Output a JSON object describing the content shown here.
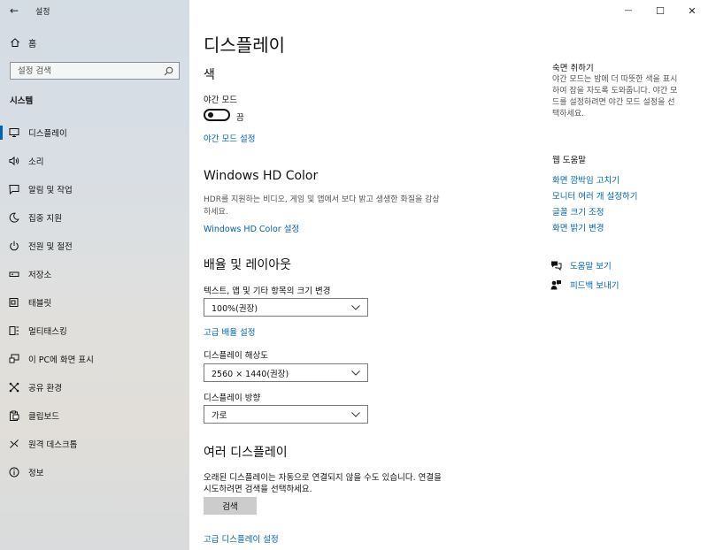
{
  "window": {
    "app_title": "설정",
    "back_glyph": "←",
    "minimize_glyph": "—",
    "maximize_glyph": "☐",
    "close_glyph": "✕"
  },
  "sidebar": {
    "home_label": "홈",
    "search_placeholder": "설정 검색",
    "section_label": "시스템",
    "items": [
      {
        "label": "디스플레이",
        "icon": "monitor-icon",
        "active": true
      },
      {
        "label": "소리",
        "icon": "speaker-icon"
      },
      {
        "label": "알림 및 작업",
        "icon": "notification-icon"
      },
      {
        "label": "집중 지원",
        "icon": "moon-icon"
      },
      {
        "label": "전원 및 절전",
        "icon": "power-icon"
      },
      {
        "label": "저장소",
        "icon": "storage-icon"
      },
      {
        "label": "태블릿",
        "icon": "tablet-icon"
      },
      {
        "label": "멀티태스킹",
        "icon": "multitasking-icon"
      },
      {
        "label": "이 PC에 화면 표시",
        "icon": "project-icon"
      },
      {
        "label": "공유 환경",
        "icon": "shared-experiences-icon"
      },
      {
        "label": "클립보드",
        "icon": "clipboard-icon"
      },
      {
        "label": "원격 데스크톱",
        "icon": "remote-desktop-icon"
      },
      {
        "label": "정보",
        "icon": "info-icon"
      }
    ]
  },
  "main": {
    "page_title": "디스플레이",
    "color": {
      "heading": "색",
      "night_light_label": "야간 모드",
      "night_light_state": "끔",
      "night_light_settings_link": "야간 모드 설정"
    },
    "hdr": {
      "heading": "Windows HD Color",
      "desc_line1": "HDR를 지원하는 비디오, 게임 및 앱에서 보다 밝고 생생한 화질을 감상",
      "desc_line2": "하세요.",
      "link": "Windows HD Color 설정"
    },
    "scale_layout": {
      "heading": "배율 및 레이아웃",
      "scale_label": "텍스트, 앱 및 기타 항목의 크기 변경",
      "scale_value": "100%(권장)",
      "advanced_scaling_link": "고급 배율 설정",
      "resolution_label": "디스플레이 해상도",
      "resolution_value": "2560 × 1440(권장)",
      "orientation_label": "디스플레이 방향",
      "orientation_value": "가로"
    },
    "multiple": {
      "heading": "여러 디스플레이",
      "desc_line1": "오래된 디스플레이는 자동으로 연결되지 않을 수도 있습니다. 연결을",
      "desc_line2": "시도하려면 검색을 선택하세요.",
      "detect_button": "검색",
      "advanced_link": "고급 디스플레이 설정"
    }
  },
  "right_panel": {
    "sleep_heading": "숙면 취하기",
    "sleep_desc_lines": [
      "야간 모드는 밤에 더 따뜻한 색을 표시",
      "하여 잠을 자도록 도와줍니다. 야간 모",
      "드를 설정하려면 야간 모드 설정을 선",
      "택하세요."
    ],
    "help_heading": "웹 도움말",
    "help_links": [
      "화면 깜박임 고치기",
      "모니터 여러 개 설정하기",
      "글꼴 크기 조정",
      "화면 밝기 변경"
    ],
    "get_help": "도움말 보기",
    "feedback": "피드백 보내기"
  },
  "colors": {
    "accent": "#0063b1"
  }
}
